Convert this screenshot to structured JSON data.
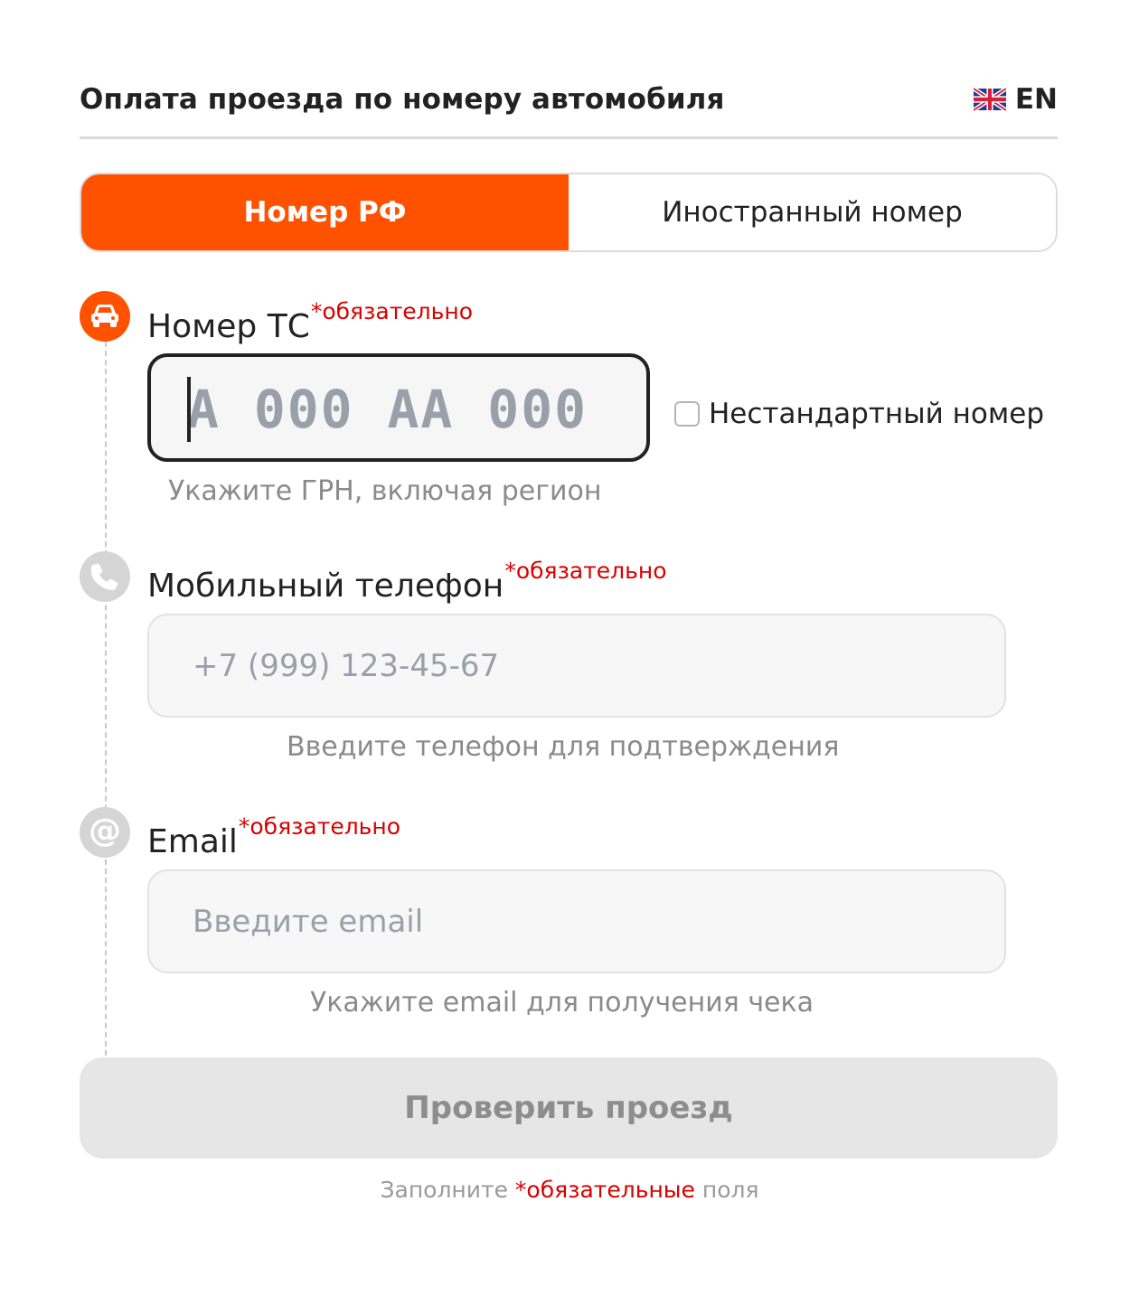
{
  "header": {
    "title": "Оплата проезда по номеру автомобиля",
    "language": "EN",
    "flag_icon": "uk-flag-icon"
  },
  "tabs": [
    {
      "label": "Номер РФ",
      "active": true
    },
    {
      "label": "Иностранный номер",
      "active": false
    }
  ],
  "vehicle": {
    "icon": "car-icon",
    "label": "Номер ТС",
    "required": "*обязательно",
    "plate_placeholder": "A 000 AA 000",
    "plate_value": "",
    "nonstandard_label": "Нестандартный номер",
    "nonstandard_checked": false,
    "hint": "Укажите ГРН, включая регион"
  },
  "phone": {
    "icon": "phone-icon",
    "label": "Мобильный телефон",
    "required": "*обязательно",
    "placeholder": "+7 (999) 123-45-67",
    "value": "",
    "hint": "Введите телефон для подтверждения"
  },
  "email": {
    "icon": "at-sign-icon",
    "label": "Email",
    "required": "*обязательно",
    "placeholder": "Введите email",
    "value": "",
    "hint": "Укажите email для получения чека"
  },
  "submit": {
    "label": "Проверить проезд",
    "disabled": true
  },
  "footer": {
    "prefix": "Заполните ",
    "required_word": "*обязательные",
    "suffix": " поля"
  },
  "colors": {
    "accent": "#ff5200",
    "required": "#d90000",
    "disabled_bg": "#e6e6e6"
  }
}
